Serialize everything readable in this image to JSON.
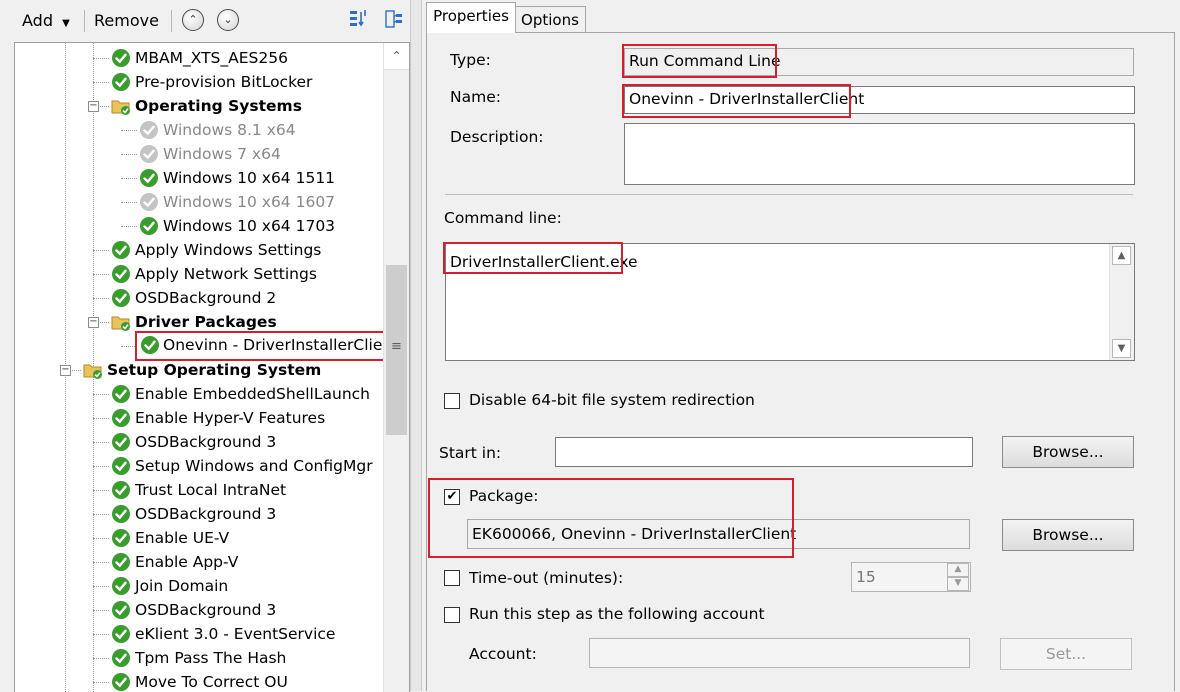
{
  "toolbar": {
    "add": "Add",
    "remove": "Remove"
  },
  "tree": {
    "items": [
      {
        "label": "MBAM_XTS_AES256",
        "status": "ok",
        "type": "step",
        "indent": 1
      },
      {
        "label": "Pre-provision BitLocker",
        "status": "ok",
        "type": "step",
        "indent": 1
      },
      {
        "label": "Operating Systems",
        "status": "ok",
        "type": "group",
        "indent": 1
      },
      {
        "label": "Windows 8.1 x64",
        "status": "disabled",
        "type": "step",
        "indent": 2
      },
      {
        "label": "Windows 7 x64",
        "status": "disabled",
        "type": "step",
        "indent": 2
      },
      {
        "label": "Windows 10 x64 1511",
        "status": "ok",
        "type": "step",
        "indent": 2
      },
      {
        "label": "Windows 10 x64 1607",
        "status": "disabled",
        "type": "step",
        "indent": 2
      },
      {
        "label": "Windows 10 x64 1703",
        "status": "ok",
        "type": "step",
        "indent": 2
      },
      {
        "label": "Apply Windows Settings",
        "status": "ok",
        "type": "step",
        "indent": 1
      },
      {
        "label": "Apply Network Settings",
        "status": "ok",
        "type": "step",
        "indent": 1
      },
      {
        "label": "OSDBackground 2",
        "status": "ok",
        "type": "step",
        "indent": 1
      },
      {
        "label": "Driver Packages",
        "status": "ok",
        "type": "group",
        "indent": 1
      },
      {
        "label": "Onevinn - DriverInstallerClient",
        "status": "ok",
        "type": "step",
        "indent": 2,
        "selected": true
      },
      {
        "label": "Setup Operating System",
        "status": "ok",
        "type": "group",
        "indent": 0
      },
      {
        "label": "Enable EmbeddedShellLaunch",
        "status": "ok",
        "type": "step",
        "indent": 1
      },
      {
        "label": "Enable Hyper-V Features",
        "status": "ok",
        "type": "step",
        "indent": 1
      },
      {
        "label": "OSDBackground 3",
        "status": "ok",
        "type": "step",
        "indent": 1
      },
      {
        "label": "Setup Windows and ConfigMgr",
        "status": "ok",
        "type": "step",
        "indent": 1
      },
      {
        "label": "Trust Local IntraNet",
        "status": "ok",
        "type": "step",
        "indent": 1
      },
      {
        "label": "OSDBackground 3",
        "status": "ok",
        "type": "step",
        "indent": 1
      },
      {
        "label": "Enable UE-V",
        "status": "ok",
        "type": "step",
        "indent": 1
      },
      {
        "label": "Enable App-V",
        "status": "ok",
        "type": "step",
        "indent": 1
      },
      {
        "label": "Join Domain",
        "status": "ok",
        "type": "step",
        "indent": 1
      },
      {
        "label": "OSDBackground 3",
        "status": "ok",
        "type": "step",
        "indent": 1
      },
      {
        "label": "eKlient 3.0 - EventService",
        "status": "ok",
        "type": "step",
        "indent": 1
      },
      {
        "label": "Tpm Pass The Hash",
        "status": "ok",
        "type": "step",
        "indent": 1
      },
      {
        "label": "Move To Correct OU",
        "status": "ok",
        "type": "step",
        "indent": 1
      }
    ]
  },
  "tabs": [
    {
      "label": "Properties",
      "active": true
    },
    {
      "label": "Options",
      "active": false
    }
  ],
  "properties": {
    "type_label": "Type:",
    "type_value": "Run Command Line",
    "name_label": "Name:",
    "name_value": "Onevinn - DriverInstallerClient",
    "description_label": "Description:",
    "description_value": "",
    "command_label": "Command line:",
    "command_value": "DriverInstallerClient.exe",
    "disable64_label": "Disable 64-bit file system redirection",
    "disable64_checked": false,
    "startin_label": "Start in:",
    "startin_value": "",
    "browse_label": "Browse...",
    "package_label": "Package:",
    "package_checked": true,
    "package_value": "EK600066, Onevinn - DriverInstallerClient",
    "timeout_label": "Time-out (minutes):",
    "timeout_checked": false,
    "timeout_value": "15",
    "runas_label": "Run this step as the following account",
    "runas_checked": false,
    "account_label": "Account:",
    "account_value": "",
    "set_label": "Set..."
  },
  "colors": {
    "highlight": "#d1202f",
    "check_green": "#3a9c2f",
    "folder": "#e8c35a"
  }
}
